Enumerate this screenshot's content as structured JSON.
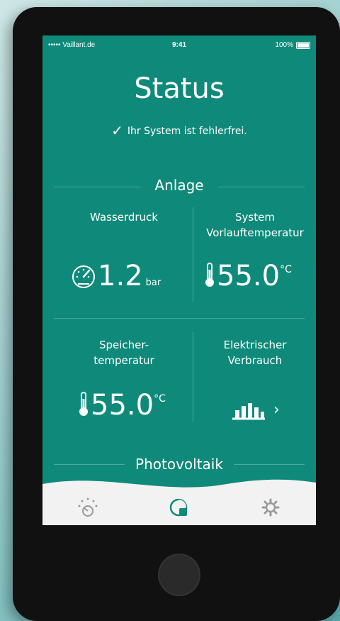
{
  "status_bar": {
    "carrier": "••••• Vaillant.de",
    "time": "9:41",
    "battery": "100%"
  },
  "header": {
    "title": "Status",
    "system_ok": "Ihr System ist fehlerfrei."
  },
  "sections": {
    "anlage": "Anlage",
    "photovoltaik": "Photovoltaik"
  },
  "tiles": {
    "wasserdruck": {
      "label": "Wasserdruck",
      "value": "1.2",
      "unit": "bar"
    },
    "system_vorlauf": {
      "label_line1": "System",
      "label_line2": "Vorlauftemperatur",
      "value": "55.0",
      "unit": "°C"
    },
    "speicher": {
      "label_line1": "Speicher-",
      "label_line2": "temperatur",
      "value": "55.0",
      "unit": "°C"
    },
    "elektrisch": {
      "label_line1": "Elektrischer",
      "label_line2": "Verbrauch",
      "chevron": "›"
    }
  },
  "nav": {
    "items": [
      "heating-icon",
      "status-icon",
      "settings-icon"
    ],
    "active": "status-icon"
  },
  "colors": {
    "screen_bg": "#0f8a7a",
    "nav_bg": "#f2f2f2",
    "accent": "#0f8a7a",
    "icon_gray": "#9a9a9a"
  }
}
